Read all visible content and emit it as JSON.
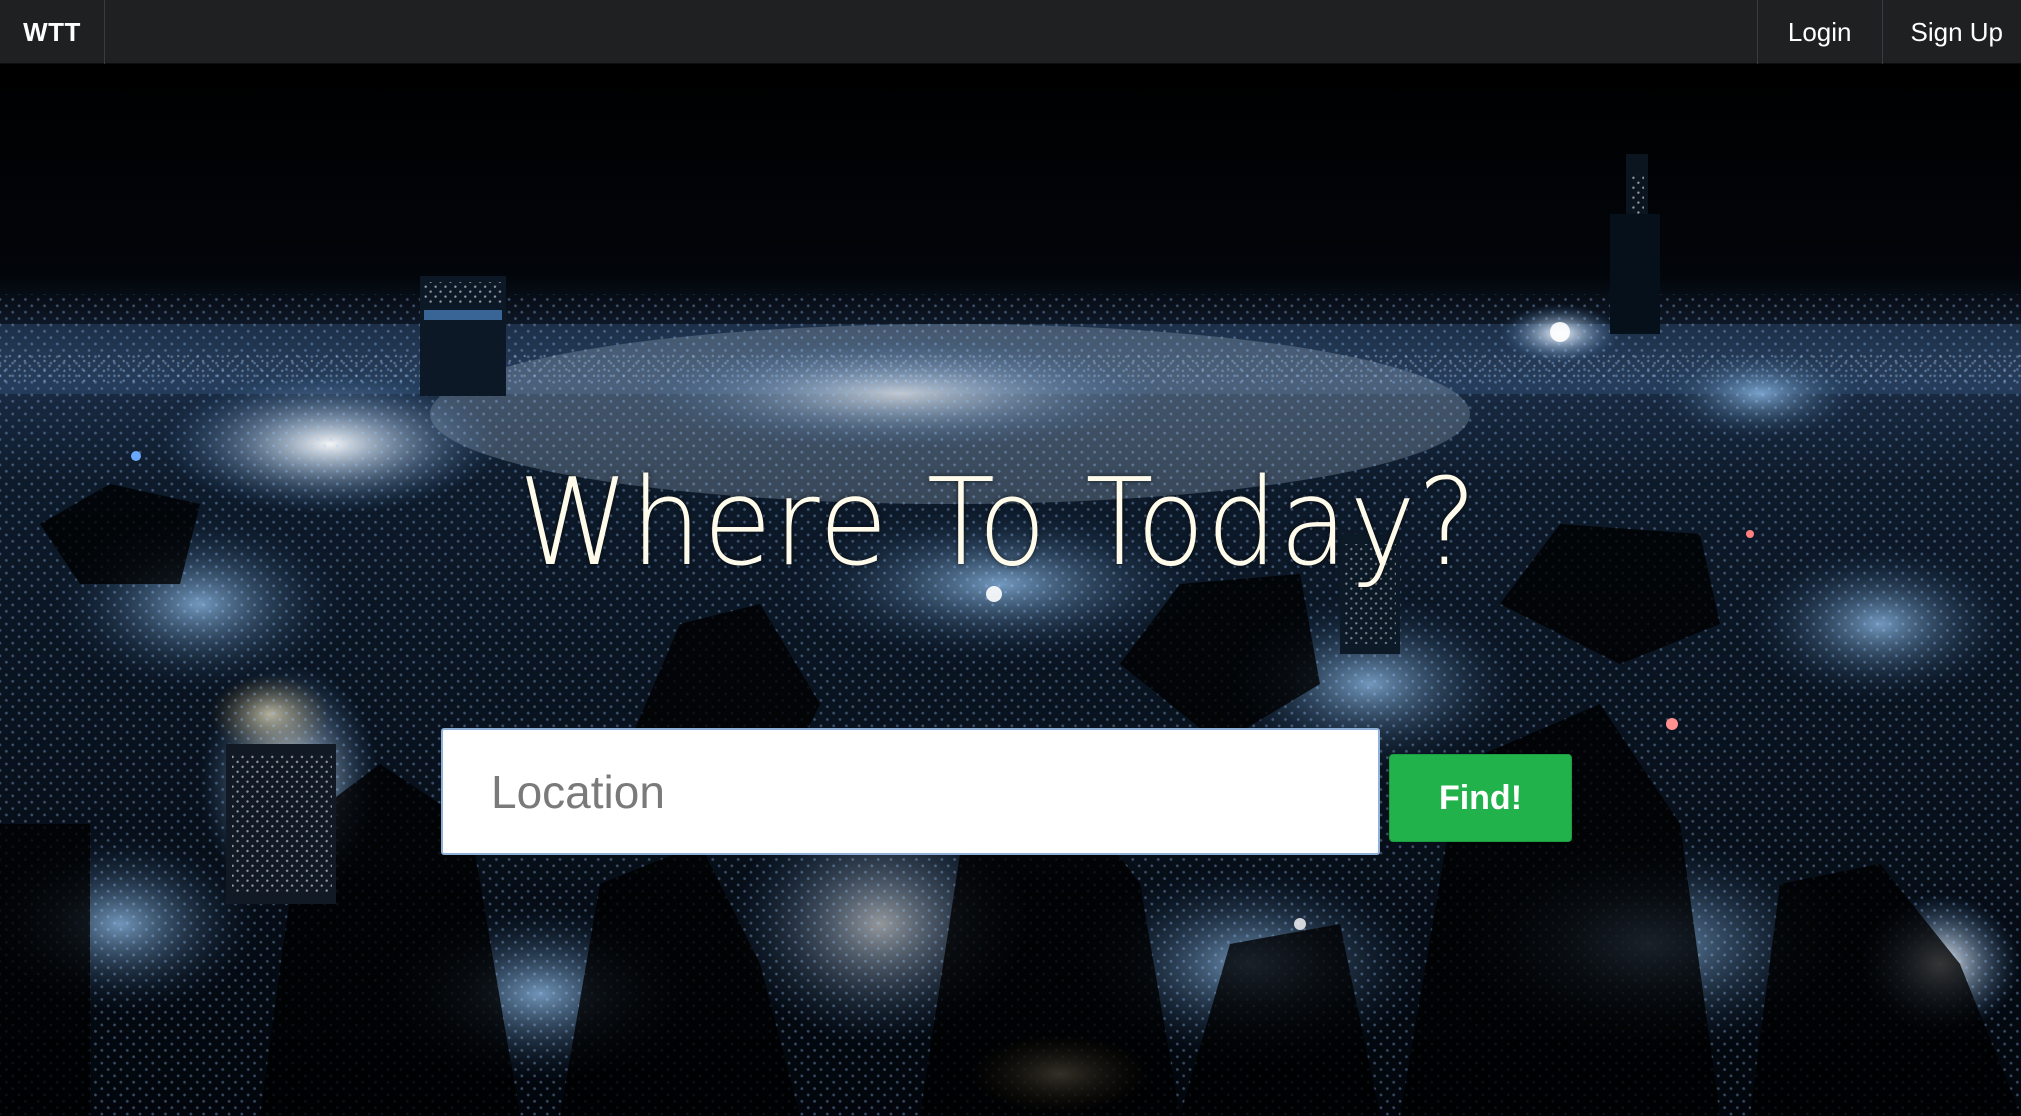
{
  "navbar": {
    "brand": "WTT",
    "links": {
      "login": "Login",
      "signup": "Sign Up"
    },
    "background": "#1f2022"
  },
  "hero": {
    "title": "Where To Today?",
    "background_image": "night-city-skyline",
    "search": {
      "placeholder": "Location",
      "value": ""
    },
    "find_button": {
      "label": "Find!",
      "color": "#22b24c"
    }
  }
}
